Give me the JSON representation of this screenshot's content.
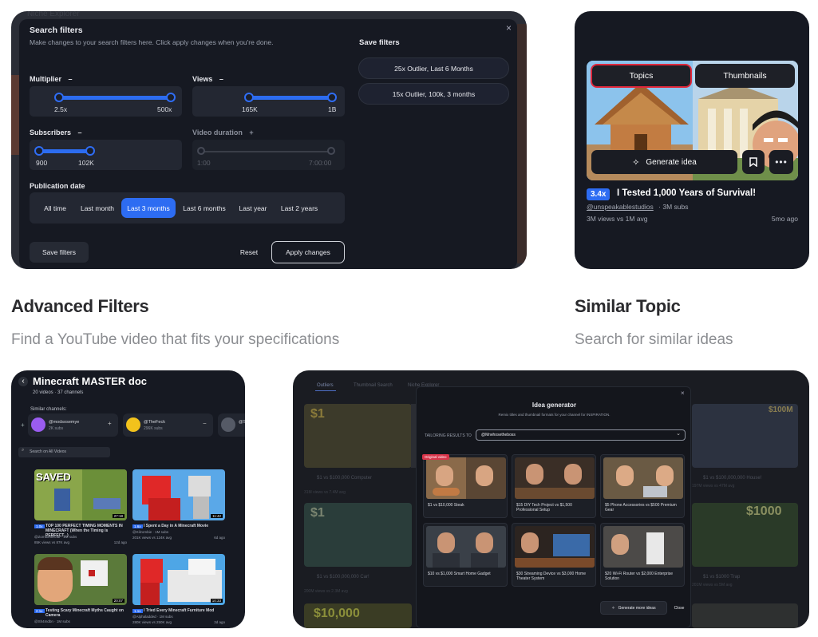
{
  "filters_card": {
    "bg_title": "Niche Explorer",
    "title": "Search filters",
    "subtitle": "Make changes to your search filters here. Click apply changes when you're done.",
    "multiplier": {
      "label": "Multiplier",
      "toggle": "–",
      "min": "2.5x",
      "max": "500x"
    },
    "views": {
      "label": "Views",
      "toggle": "–",
      "min": "165K",
      "max": "1B"
    },
    "subscribers": {
      "label": "Subscribers",
      "toggle": "–",
      "min": "900",
      "max": "102K"
    },
    "duration": {
      "label": "Video duration",
      "toggle": "+",
      "min": "1:00",
      "max": "7:00:00"
    },
    "pub_label": "Publication date",
    "pub_options": [
      "All time",
      "Last month",
      "Last 3 months",
      "Last 6 months",
      "Last year",
      "Last 2 years"
    ],
    "save_filters_btn": "Save filters",
    "reset_btn": "Reset",
    "apply_btn": "Apply changes",
    "close": "×",
    "saved_title": "Save filters",
    "saved": [
      "25x Outlier, Last 6 Months",
      "15x Outlier, 100k, 3 months"
    ]
  },
  "topic_card": {
    "tab_topics": "Topics",
    "tab_thumbnails": "Thumbnails",
    "generate": "Generate idea",
    "multiplier": "3.4x",
    "title": "I Tested 1,000 Years of Survival!",
    "channel": "@unspeakablestudios",
    "subs": "· 3M subs",
    "views": "3M views vs 1M avg",
    "age": "5mo ago"
  },
  "captions": {
    "left_title": "Advanced Filters",
    "left_sub": "Find a YouTube video that fits your specifications",
    "right_title": "Similar Topic",
    "right_sub": "Search for similar ideas"
  },
  "doc_card": {
    "back": "‹",
    "title": "Minecraft MASTER doc",
    "meta": "20 videos · 37 channels",
    "similar": "Similar channels:",
    "channels": [
      {
        "name": "@modsosemye",
        "subs": "2K subs"
      },
      {
        "name": "@TheFeck",
        "subs": "296K subs"
      },
      {
        "name": "@S",
        "subs": ""
      }
    ],
    "search": "Search on All Videos",
    "videos": [
      {
        "badge": "1.0x",
        "title": "TOP 100 PERFECT TIMING MOMENTS IN MINECRAFT (When the Timing is PERFECT...)",
        "channel": "@Zombieofficial · 1M subs",
        "stats": "85K views vs 87K avg",
        "age": "12d ago",
        "dur": "27:18",
        "overlay": "SAVED"
      },
      {
        "badge": "1.6x",
        "title": "I Spent a Day in A Minecraft Movie",
        "channel": "@Kilzombie · 1M subs",
        "stats": "201K views vs 124K avg",
        "age": "6d ago",
        "dur": "11:42"
      },
      {
        "badge": "2.1x",
        "title": "Testing Scary Minecraft Myths Caught on Camera",
        "channel": "@Sh4mdbn · 1M subs",
        "stats": "",
        "age": "",
        "dur": "20:07"
      },
      {
        "badge": "1.1x",
        "title": "I Tried Every Minecraft Furniture Mod",
        "channel": "@Alphaladded · 1M subs",
        "stats": "280K views vs 250K avg",
        "age": "3d ago",
        "dur": "10:33"
      }
    ]
  },
  "idea_card": {
    "tabs": [
      "Outliers",
      "Thumbnail Search",
      "Niche Explorer"
    ],
    "title": "Idea generator",
    "subtitle": "Remix titles and thumbnail formats for your channel for INSPIRATION.",
    "tailoring_label": "TAILORING RESULTS TO",
    "channel": "@Mrwhosetheboss",
    "original_badge": "Original video",
    "ideas": [
      "$1 vs $10,000 Steak",
      "$15 DIY Tech Project vs $1,500 Professional Setup",
      "$5 Phone Accessories vs $500 Premium Gear",
      "$10 vs $1,000 Smart Home Gadget",
      "$30 Streaming Device vs $3,000 Home Theater System",
      "$20 Wi-Fi Router vs $2,000 Enterprise Solution"
    ],
    "more_btn": "Generate more ideas",
    "close_btn": "Close",
    "close_x": "×",
    "bg_left": [
      {
        "badge": "$1",
        "title": "$1 vs $100,000 Computer",
        "stats": "31M views vs 7.4M avg"
      },
      {
        "badge": "$1",
        "title": "$1 vs $100,000,000 Car!",
        "stats": "200M views vs 2.3M avg"
      }
    ],
    "bg_right": [
      {
        "badge": "$100M",
        "title": "$1 vs $100,000,000 House!",
        "stats": "197M views vs 47M avg"
      },
      {
        "badge": "$1000",
        "title": "$1 vs $1000 Trap",
        "stats": "201M views vs 5M avg"
      }
    ],
    "bottom_label": "$10,000"
  }
}
